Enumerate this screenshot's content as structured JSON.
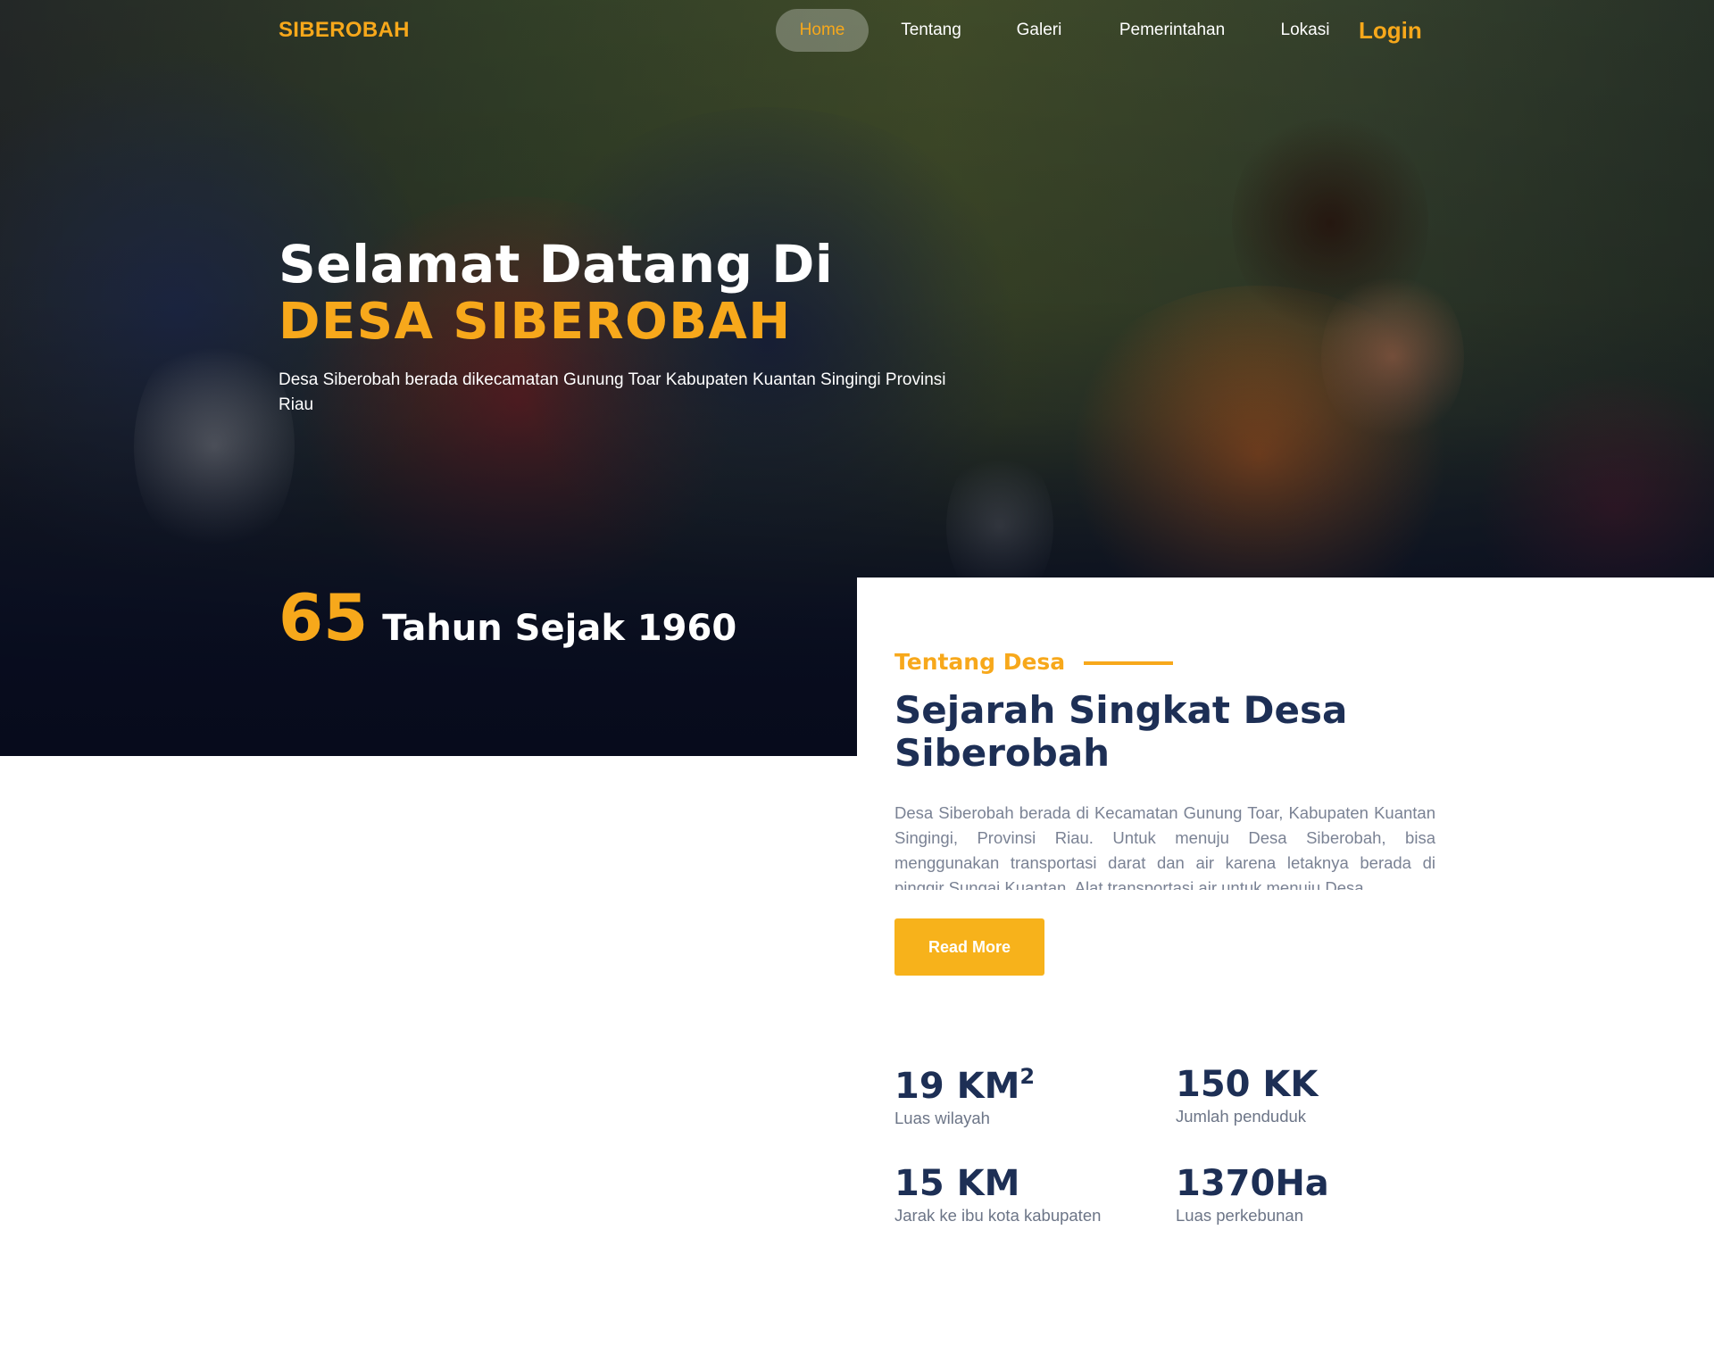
{
  "nav": {
    "brand": "SIBEROBAH",
    "items": [
      {
        "label": "Home",
        "active": true
      },
      {
        "label": "Tentang",
        "active": false
      },
      {
        "label": "Galeri",
        "active": false
      },
      {
        "label": "Pemerintahan",
        "active": false
      },
      {
        "label": "Lokasi",
        "active": false
      }
    ],
    "login": "Login"
  },
  "hero": {
    "title_line1": "Selamat Datang Di",
    "title_line2": "DESA SIBEROBAH",
    "description": "Desa Siberobah berada dikecamatan Gunung Toar Kabupaten Kuantan Singingi Provinsi Riau",
    "years_number": "65",
    "years_label": "Tahun Sejak 1960"
  },
  "about": {
    "kicker": "Tentang Desa",
    "title": "Sejarah Singkat Desa Siberobah",
    "text": "Desa Siberobah berada di Kecamatan Gunung Toar, Kabupaten Kuantan Singingi, Provinsi Riau. Untuk menuju Desa Siberobah, bisa menggunakan transportasi darat dan air karena letaknya berada di pinggir Sungai Kuantan. Alat transportasi air untuk menuju Desa",
    "read_more": "Read More"
  },
  "stats": [
    {
      "value": "19 KM",
      "sup": "2",
      "label": "Luas wilayah"
    },
    {
      "value": "150 KK",
      "sup": "",
      "label": "Jumlah penduduk"
    },
    {
      "value": "15 KM",
      "sup": "",
      "label": "Jarak ke ibu kota kabupaten"
    },
    {
      "value": "1370Ha",
      "sup": "",
      "label": "Luas perkebunan"
    }
  ],
  "colors": {
    "accent": "#f7a81b",
    "navy": "#1d2f55",
    "text_muted": "#7a8294"
  }
}
